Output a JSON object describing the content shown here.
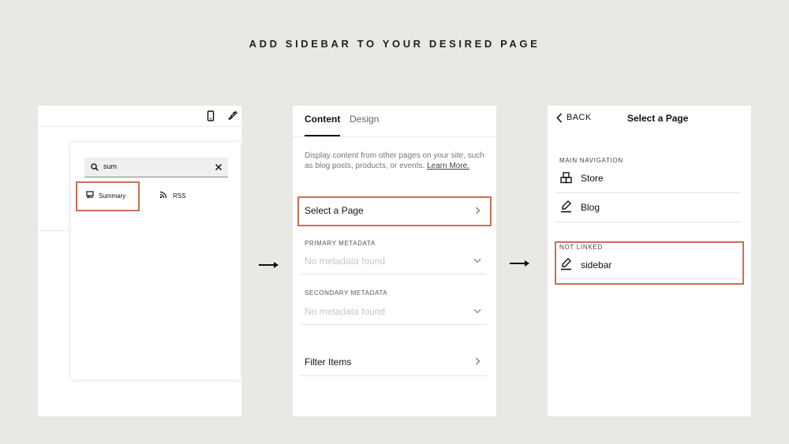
{
  "heading": "ADD SIDEBAR TO YOUR DESIRED PAGE",
  "accent_color": "#c86f58",
  "panel1": {
    "toolbar_icons": [
      "mobile-icon",
      "paintbrush-icon"
    ],
    "search": {
      "value": "sum",
      "icon": "search-icon",
      "clear_icon": "close-icon"
    },
    "results": [
      {
        "label": "Summary",
        "icon": "summary-block-icon"
      },
      {
        "label": "RSS",
        "icon": "rss-icon"
      }
    ]
  },
  "panel2": {
    "tabs": {
      "content": "Content",
      "design": "Design",
      "active": "Content"
    },
    "description": "Display content from other pages on your site, such as blog posts, products, or events.",
    "learn_more": "Learn More.",
    "select_page": "Select a Page",
    "primary_metadata": {
      "heading": "PRIMARY METADATA",
      "value": "No metadata found"
    },
    "secondary_metadata": {
      "heading": "SECONDARY METADATA",
      "value": "No metadata found"
    },
    "filter_items": "Filter Items"
  },
  "panel3": {
    "back": "BACK",
    "title": "Select a Page",
    "main_navigation": {
      "heading": "MAIN NAVIGATION",
      "items": [
        "Store",
        "Blog"
      ]
    },
    "not_linked": {
      "heading": "NOT LINKED",
      "items": [
        "sidebar"
      ]
    }
  }
}
